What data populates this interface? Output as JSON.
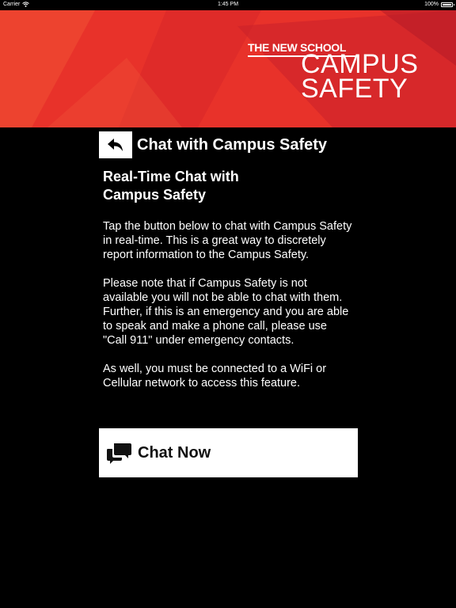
{
  "status_bar": {
    "carrier": "Carrier",
    "time": "1:45 PM",
    "battery": "100%"
  },
  "banner": {
    "logo_small": "THE NEW SCHOOL",
    "logo_line1": "CAMPUS",
    "logo_line2": "SAFETY",
    "colors": {
      "base": "#e8322a",
      "dark": "#c8202a",
      "light": "#f04a32"
    }
  },
  "header": {
    "title": "Chat with Campus Safety",
    "back_icon": "back-arrow-icon"
  },
  "content": {
    "heading_line1": "Real-Time Chat with",
    "heading_line2": "Campus Safety",
    "paragraph1": "Tap the button below to chat with Campus Safety in real-time. This is a great way to discretely report information to the Campus Safety.",
    "paragraph2": "Please note that if Campus Safety is not available you will not be able to chat with them. Further, if this is an emergency and you are able to speak and make a phone call, please use \"Call 911\" under emergency contacts.",
    "paragraph3": "As well, you must be connected to a WiFi or Cellular network to access this feature."
  },
  "chat_button": {
    "label": "Chat Now",
    "icon": "chat-bubbles-icon"
  }
}
